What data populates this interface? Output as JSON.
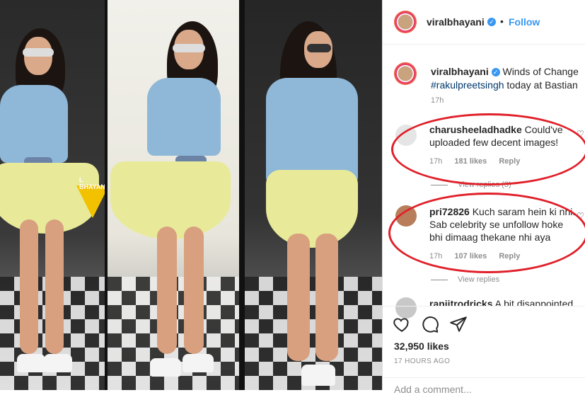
{
  "post": {
    "author": "viralbhayani",
    "follow_label": "Follow",
    "separator": "•",
    "watermark": "L BHAYANI",
    "caption_text": "Winds of Change",
    "caption_tag": "#rakulpreetsingh",
    "caption_rest": " today at Bastian",
    "caption_time": "17h",
    "likes": "32,950 likes",
    "time_ago": "17 HOURS AGO",
    "add_comment_placeholder": "Add a comment..."
  },
  "comments": [
    {
      "user": "charusheeladhadke",
      "text": "Could've uploaded few decent images!",
      "time": "17h",
      "likes": "181 likes",
      "reply": "Reply",
      "view_replies": "View replies (3)"
    },
    {
      "user": "pri72826",
      "text": "Kuch saram hein ki nhi. Sab celebrity se unfollow hoke bhi dimaag thekane nhi aya",
      "time": "17h",
      "likes": "107 likes",
      "reply": "Reply",
      "view_replies": "View replies"
    },
    {
      "user": "ranjitrodricks",
      "text": "A bit disappointed",
      "time": "",
      "likes": "",
      "reply": "",
      "view_replies": ""
    }
  ],
  "icons": [
    "heart-icon",
    "comment-icon",
    "share-icon",
    "verified-icon"
  ],
  "colors": {
    "accent": "#3897f0",
    "annotation": "#e0202a",
    "text": "#262626",
    "muted": "#8e8e8e"
  }
}
